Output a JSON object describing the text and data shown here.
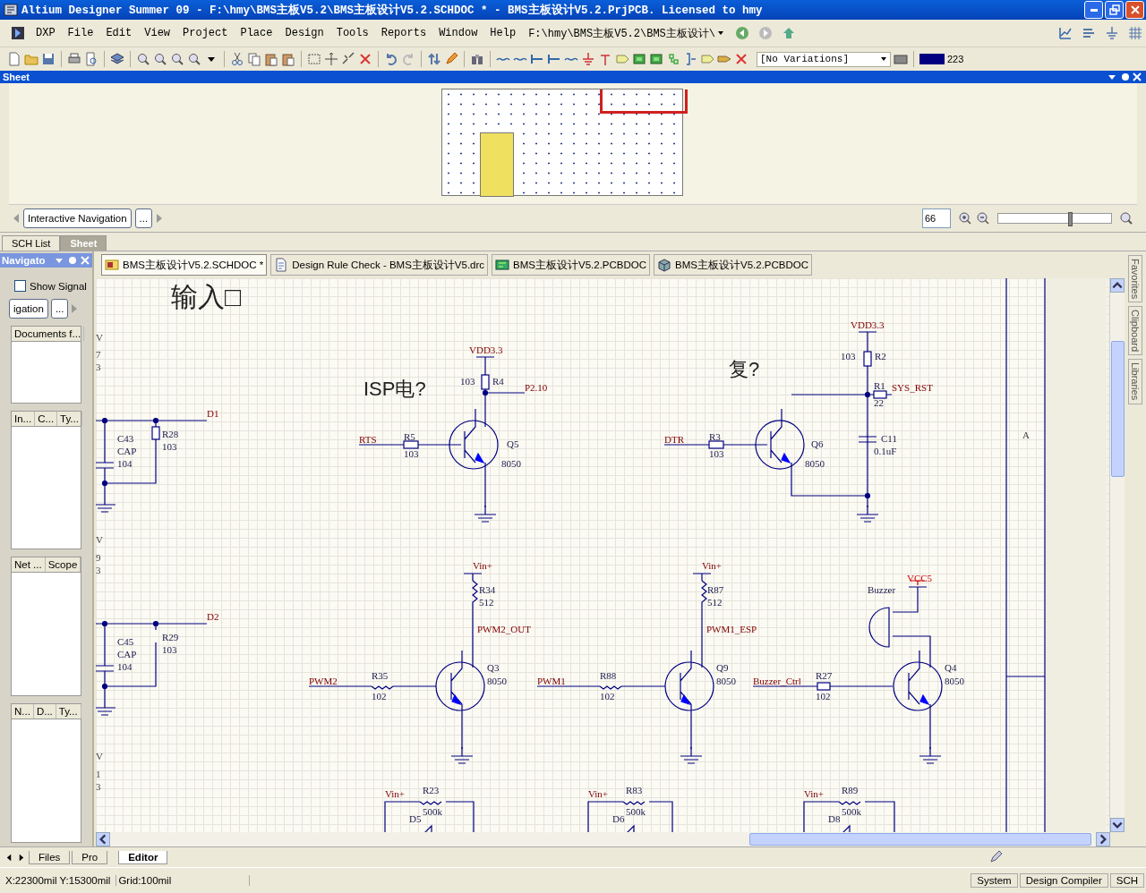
{
  "window": {
    "title": "Altium Designer Summer 09 - F:\\hmy\\BMS主板V5.2\\BMS主板设计V5.2.SCHDOC * - BMS主板设计V5.2.PrjPCB. Licensed to hmy"
  },
  "menu_bar": {
    "items": [
      "DXP",
      "File",
      "Edit",
      "View",
      "Project",
      "Place",
      "Design",
      "Tools",
      "Reports",
      "Window",
      "Help"
    ],
    "path": "F:\\hmy\\BMS主板V5.2\\BMS主板设计\\"
  },
  "toolbar": {
    "variations": "[No Variations]",
    "color_value": "223"
  },
  "sheet_panel": {
    "title": "Sheet",
    "navigation_button": "Interactive Navigation",
    "more_button": "...",
    "zoom": "66",
    "zoom_slider": {
      "level": 0.62
    }
  },
  "panel_tabs": [
    {
      "label": "SCH List",
      "selected": false
    },
    {
      "label": "Sheet",
      "selected": true
    }
  ],
  "navigator": {
    "title": "Navigato",
    "show_signal": {
      "label": "Show Signal",
      "checked": false
    },
    "navigation_button": "igation",
    "more_button": "...",
    "documents_header": "Documents f...",
    "instances_columns": [
      "In...",
      "C...",
      "Ty..."
    ],
    "nets_columns": [
      "Net ...",
      "Scope"
    ],
    "nodes_columns": [
      "N...",
      "D...",
      "Ty..."
    ]
  },
  "document_tabs": [
    {
      "label": "BMS主板设计V5.2.SCHDOC *",
      "kind": "schematic",
      "selected": true
    },
    {
      "label": "Design Rule Check - BMS主板设计V5.drc",
      "kind": "report",
      "selected": false
    },
    {
      "label": "BMS主板设计V5.2.PCBDOC",
      "kind": "pcb",
      "selected": false
    },
    {
      "label": "BMS主板设计V5.2.PCBDOC",
      "kind": "pcb3d",
      "selected": false
    }
  ],
  "side_tabs": [
    "Favorites",
    "Clipboard",
    "Libraries"
  ],
  "schematic": {
    "labels": [
      {
        "text": "输入□",
        "kind": "note"
      },
      {
        "text": "ISP电?",
        "kind": "note"
      },
      {
        "text": "复?",
        "kind": "note"
      },
      {
        "text": "V",
        "kind": "fragment"
      },
      {
        "text": "7",
        "kind": "fragment"
      },
      {
        "text": "3",
        "kind": "fragment"
      },
      {
        "text": "V",
        "kind": "fragment"
      },
      {
        "text": "9",
        "kind": "fragment"
      },
      {
        "text": "3",
        "kind": "fragment"
      },
      {
        "text": "V",
        "kind": "fragment"
      },
      {
        "text": "1",
        "kind": "fragment"
      },
      {
        "text": "3",
        "kind": "fragment"
      },
      {
        "text": "D1",
        "kind": "net"
      },
      {
        "text": "C43",
        "kind": "designator"
      },
      {
        "text": "CAP",
        "kind": "value"
      },
      {
        "text": "104",
        "kind": "value"
      },
      {
        "text": "R28",
        "kind": "designator"
      },
      {
        "text": "103",
        "kind": "value"
      },
      {
        "text": "D2",
        "kind": "net"
      },
      {
        "text": "C45",
        "kind": "designator"
      },
      {
        "text": "CAP",
        "kind": "value"
      },
      {
        "text": "104",
        "kind": "value"
      },
      {
        "text": "R29",
        "kind": "designator"
      },
      {
        "text": "103",
        "kind": "value"
      },
      {
        "text": "VDD3.3",
        "kind": "power"
      },
      {
        "text": "103",
        "kind": "value"
      },
      {
        "text": "R4",
        "kind": "designator"
      },
      {
        "text": "P2.10",
        "kind": "net"
      },
      {
        "text": "RTS",
        "kind": "net"
      },
      {
        "text": "R5",
        "kind": "designator"
      },
      {
        "text": "103",
        "kind": "value"
      },
      {
        "text": "Q5",
        "kind": "designator"
      },
      {
        "text": "8050",
        "kind": "value"
      },
      {
        "text": "VDD3.3",
        "kind": "power"
      },
      {
        "text": "103",
        "kind": "value"
      },
      {
        "text": "R2",
        "kind": "designator"
      },
      {
        "text": "R1",
        "kind": "designator"
      },
      {
        "text": "SYS_RST",
        "kind": "net"
      },
      {
        "text": "22",
        "kind": "value"
      },
      {
        "text": "DTR",
        "kind": "net"
      },
      {
        "text": "R3",
        "kind": "designator"
      },
      {
        "text": "103",
        "kind": "value"
      },
      {
        "text": "Q6",
        "kind": "designator"
      },
      {
        "text": "8050",
        "kind": "value"
      },
      {
        "text": "C11",
        "kind": "designator"
      },
      {
        "text": "0.1uF",
        "kind": "value"
      },
      {
        "text": "Vin+",
        "kind": "power"
      },
      {
        "text": "R34",
        "kind": "designator"
      },
      {
        "text": "512",
        "kind": "value"
      },
      {
        "text": "PWM2_OUT",
        "kind": "net"
      },
      {
        "text": "PWM2",
        "kind": "net"
      },
      {
        "text": "R35",
        "kind": "designator"
      },
      {
        "text": "102",
        "kind": "value"
      },
      {
        "text": "Q3",
        "kind": "designator"
      },
      {
        "text": "8050",
        "kind": "value"
      },
      {
        "text": "Vin+",
        "kind": "power"
      },
      {
        "text": "R87",
        "kind": "designator"
      },
      {
        "text": "512",
        "kind": "value"
      },
      {
        "text": "PWM1_ESP",
        "kind": "net"
      },
      {
        "text": "PWM1",
        "kind": "net"
      },
      {
        "text": "R88",
        "kind": "designator"
      },
      {
        "text": "102",
        "kind": "value"
      },
      {
        "text": "Q9",
        "kind": "designator"
      },
      {
        "text": "8050",
        "kind": "value"
      },
      {
        "text": "Buzzer",
        "kind": "designator"
      },
      {
        "text": "VCC5",
        "kind": "supply"
      },
      {
        "text": "Buzzer_Ctrl",
        "kind": "net"
      },
      {
        "text": "R27",
        "kind": "designator"
      },
      {
        "text": "102",
        "kind": "value"
      },
      {
        "text": "Q4",
        "kind": "designator"
      },
      {
        "text": "8050",
        "kind": "value"
      },
      {
        "text": "Vin+",
        "kind": "power"
      },
      {
        "text": "R23",
        "kind": "designator"
      },
      {
        "text": "500k",
        "kind": "value"
      },
      {
        "text": "D5",
        "kind": "designator"
      },
      {
        "text": "Vin+",
        "kind": "power"
      },
      {
        "text": "R83",
        "kind": "designator"
      },
      {
        "text": "500k",
        "kind": "value"
      },
      {
        "text": "D6",
        "kind": "designator"
      },
      {
        "text": "Vin+",
        "kind": "power"
      },
      {
        "text": "R89",
        "kind": "designator"
      },
      {
        "text": "500k",
        "kind": "value"
      },
      {
        "text": "D8",
        "kind": "designator"
      },
      {
        "text": "A",
        "kind": "zone"
      }
    ]
  },
  "bottom_tabs": [
    {
      "label": "Files",
      "selected": false
    },
    {
      "label": "Pro",
      "selected": false
    },
    {
      "label": "Editor",
      "selected": true
    }
  ],
  "status_bar": {
    "coordinates": "X:22300mil Y:15300mil",
    "grid": "Grid:100mil",
    "panels": [
      "System",
      "Design Compiler",
      "SCH"
    ]
  }
}
